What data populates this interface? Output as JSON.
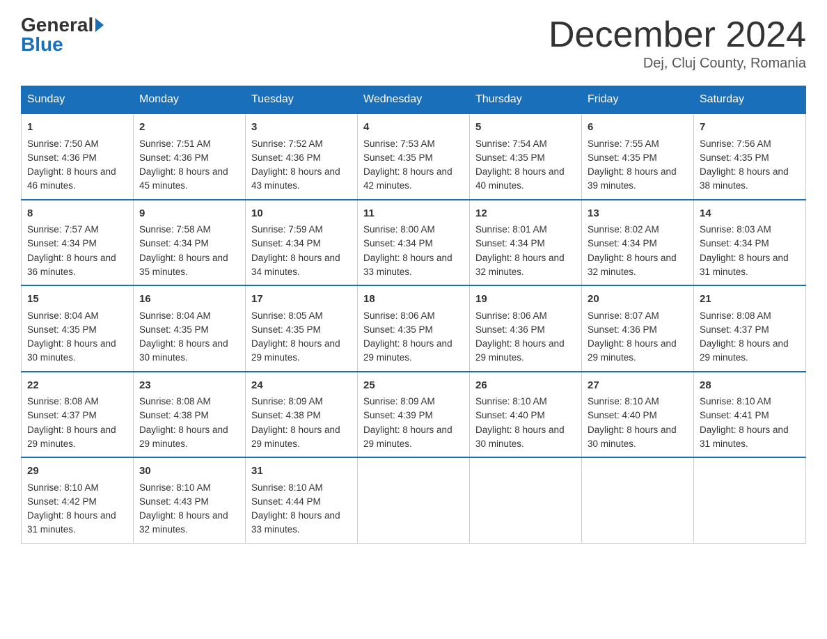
{
  "header": {
    "logo_general": "General",
    "logo_blue": "Blue",
    "month_title": "December 2024",
    "location": "Dej, Cluj County, Romania"
  },
  "days_of_week": [
    "Sunday",
    "Monday",
    "Tuesday",
    "Wednesday",
    "Thursday",
    "Friday",
    "Saturday"
  ],
  "weeks": [
    [
      {
        "day": "1",
        "sunrise": "7:50 AM",
        "sunset": "4:36 PM",
        "daylight": "8 hours and 46 minutes."
      },
      {
        "day": "2",
        "sunrise": "7:51 AM",
        "sunset": "4:36 PM",
        "daylight": "8 hours and 45 minutes."
      },
      {
        "day": "3",
        "sunrise": "7:52 AM",
        "sunset": "4:36 PM",
        "daylight": "8 hours and 43 minutes."
      },
      {
        "day": "4",
        "sunrise": "7:53 AM",
        "sunset": "4:35 PM",
        "daylight": "8 hours and 42 minutes."
      },
      {
        "day": "5",
        "sunrise": "7:54 AM",
        "sunset": "4:35 PM",
        "daylight": "8 hours and 40 minutes."
      },
      {
        "day": "6",
        "sunrise": "7:55 AM",
        "sunset": "4:35 PM",
        "daylight": "8 hours and 39 minutes."
      },
      {
        "day": "7",
        "sunrise": "7:56 AM",
        "sunset": "4:35 PM",
        "daylight": "8 hours and 38 minutes."
      }
    ],
    [
      {
        "day": "8",
        "sunrise": "7:57 AM",
        "sunset": "4:34 PM",
        "daylight": "8 hours and 36 minutes."
      },
      {
        "day": "9",
        "sunrise": "7:58 AM",
        "sunset": "4:34 PM",
        "daylight": "8 hours and 35 minutes."
      },
      {
        "day": "10",
        "sunrise": "7:59 AM",
        "sunset": "4:34 PM",
        "daylight": "8 hours and 34 minutes."
      },
      {
        "day": "11",
        "sunrise": "8:00 AM",
        "sunset": "4:34 PM",
        "daylight": "8 hours and 33 minutes."
      },
      {
        "day": "12",
        "sunrise": "8:01 AM",
        "sunset": "4:34 PM",
        "daylight": "8 hours and 32 minutes."
      },
      {
        "day": "13",
        "sunrise": "8:02 AM",
        "sunset": "4:34 PM",
        "daylight": "8 hours and 32 minutes."
      },
      {
        "day": "14",
        "sunrise": "8:03 AM",
        "sunset": "4:34 PM",
        "daylight": "8 hours and 31 minutes."
      }
    ],
    [
      {
        "day": "15",
        "sunrise": "8:04 AM",
        "sunset": "4:35 PM",
        "daylight": "8 hours and 30 minutes."
      },
      {
        "day": "16",
        "sunrise": "8:04 AM",
        "sunset": "4:35 PM",
        "daylight": "8 hours and 30 minutes."
      },
      {
        "day": "17",
        "sunrise": "8:05 AM",
        "sunset": "4:35 PM",
        "daylight": "8 hours and 29 minutes."
      },
      {
        "day": "18",
        "sunrise": "8:06 AM",
        "sunset": "4:35 PM",
        "daylight": "8 hours and 29 minutes."
      },
      {
        "day": "19",
        "sunrise": "8:06 AM",
        "sunset": "4:36 PM",
        "daylight": "8 hours and 29 minutes."
      },
      {
        "day": "20",
        "sunrise": "8:07 AM",
        "sunset": "4:36 PM",
        "daylight": "8 hours and 29 minutes."
      },
      {
        "day": "21",
        "sunrise": "8:08 AM",
        "sunset": "4:37 PM",
        "daylight": "8 hours and 29 minutes."
      }
    ],
    [
      {
        "day": "22",
        "sunrise": "8:08 AM",
        "sunset": "4:37 PM",
        "daylight": "8 hours and 29 minutes."
      },
      {
        "day": "23",
        "sunrise": "8:08 AM",
        "sunset": "4:38 PM",
        "daylight": "8 hours and 29 minutes."
      },
      {
        "day": "24",
        "sunrise": "8:09 AM",
        "sunset": "4:38 PM",
        "daylight": "8 hours and 29 minutes."
      },
      {
        "day": "25",
        "sunrise": "8:09 AM",
        "sunset": "4:39 PM",
        "daylight": "8 hours and 29 minutes."
      },
      {
        "day": "26",
        "sunrise": "8:10 AM",
        "sunset": "4:40 PM",
        "daylight": "8 hours and 30 minutes."
      },
      {
        "day": "27",
        "sunrise": "8:10 AM",
        "sunset": "4:40 PM",
        "daylight": "8 hours and 30 minutes."
      },
      {
        "day": "28",
        "sunrise": "8:10 AM",
        "sunset": "4:41 PM",
        "daylight": "8 hours and 31 minutes."
      }
    ],
    [
      {
        "day": "29",
        "sunrise": "8:10 AM",
        "sunset": "4:42 PM",
        "daylight": "8 hours and 31 minutes."
      },
      {
        "day": "30",
        "sunrise": "8:10 AM",
        "sunset": "4:43 PM",
        "daylight": "8 hours and 32 minutes."
      },
      {
        "day": "31",
        "sunrise": "8:10 AM",
        "sunset": "4:44 PM",
        "daylight": "8 hours and 33 minutes."
      },
      null,
      null,
      null,
      null
    ]
  ],
  "labels": {
    "sunrise": "Sunrise: ",
    "sunset": "Sunset: ",
    "daylight": "Daylight: "
  }
}
